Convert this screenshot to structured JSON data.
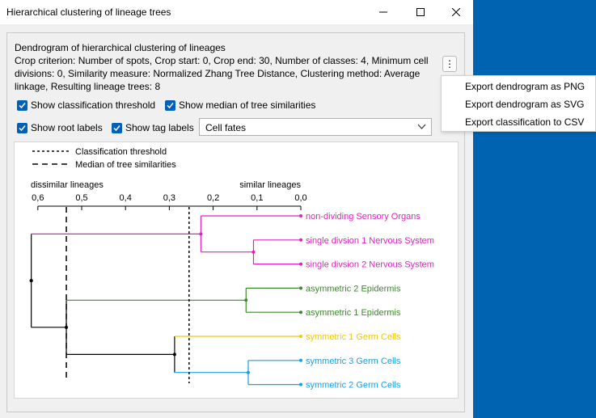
{
  "window": {
    "title": "Hierarchical clustering of lineage trees"
  },
  "description": {
    "heading": "Dendrogram of hierarchical clustering of lineages",
    "details": "Crop criterion: Number of spots, Crop start: 0, Crop end: 30, Number of classes: 4, Minimum cell divisions: 0, Similarity measure: Normalized Zhang Tree Distance, Clustering method: Average linkage, Resulting lineage trees: 8"
  },
  "options": {
    "show_classification_threshold": {
      "label": "Show classification threshold",
      "checked": true
    },
    "show_median": {
      "label": "Show median of tree similarities",
      "checked": true
    },
    "show_root_labels": {
      "label": "Show root labels",
      "checked": true
    },
    "show_tag_labels": {
      "label": "Show tag labels",
      "checked": true
    },
    "tag_select": {
      "value": "Cell fates"
    }
  },
  "menu": {
    "items": [
      "Export dendrogram as PNG",
      "Export dendrogram as SVG",
      "Export classification to CSV"
    ]
  },
  "chart_data": {
    "type": "dendrogram",
    "legend": [
      "Classification threshold",
      "Median of tree similarities"
    ],
    "axis_left_label": "dissimilar lineages",
    "axis_right_label": "similar lineages",
    "ticks": [
      "0,6",
      "0,5",
      "0,4",
      "0,3",
      "0,2",
      "0,1",
      "0,0"
    ],
    "xlim": [
      0.6,
      0.0
    ],
    "threshold": 0.255,
    "median": 0.535,
    "colors": {
      "sensory": "#e020c0",
      "epidermis": "#3a8a2a",
      "germ_yellow": "#f0c800",
      "germ_blue": "#1a9ee0",
      "tree": "#000000"
    },
    "leaves": [
      {
        "label": "non-dividing Sensory Organs",
        "color": "#e020c0"
      },
      {
        "label": "single divsion 1 Nervous System",
        "color": "#e020c0"
      },
      {
        "label": "single divsion 2 Nervous System",
        "color": "#e020c0"
      },
      {
        "label": "asymmetric 2 Epidermis",
        "color": "#3a8a2a"
      },
      {
        "label": "asymmetric 1 Epidermis",
        "color": "#3a8a2a"
      },
      {
        "label": "symmetric 1 Germ Cells",
        "color": "#f0c800"
      },
      {
        "label": "symmetric 3 Germ Cells",
        "color": "#1a9ee0"
      },
      {
        "label": "symmetric 2 Germ Cells",
        "color": "#1a9ee0"
      }
    ],
    "merges": [
      {
        "id": "n1",
        "children": [
          1,
          2
        ],
        "height": 0.108,
        "color": "#e020c0"
      },
      {
        "id": "n2",
        "children": [
          0,
          "n1"
        ],
        "height": 0.228,
        "color": "#e020c0"
      },
      {
        "id": "n3",
        "children": [
          3,
          4
        ],
        "height": 0.125,
        "color": "#3a8a2a"
      },
      {
        "id": "n4",
        "children": [
          6,
          7
        ],
        "height": 0.12,
        "color": "#1a9ee0"
      },
      {
        "id": "n5",
        "children": [
          5,
          "n4"
        ],
        "height": 0.288,
        "color": "#000000"
      },
      {
        "id": "n6",
        "children": [
          "n3",
          "n5"
        ],
        "height": 0.535,
        "color": "#000000"
      },
      {
        "id": "n7",
        "children": [
          "n2",
          "n6"
        ],
        "height": 0.615,
        "color": "#000000"
      }
    ]
  }
}
